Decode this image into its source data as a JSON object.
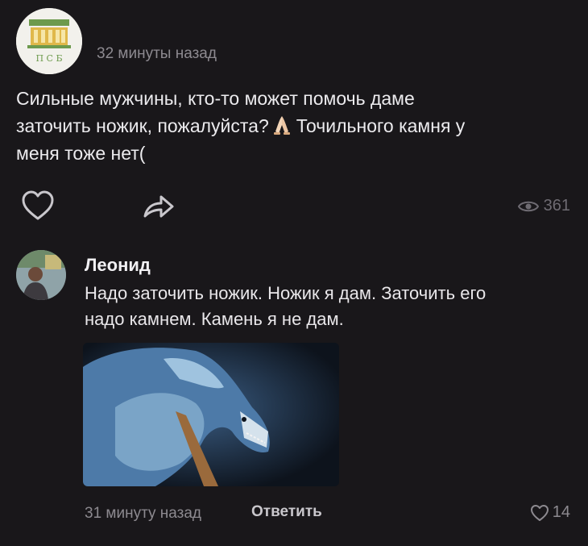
{
  "post": {
    "time": "32 минуты назад",
    "text_lines": [
      "Сильные мужчины, кто-то может помочь даме",
      "заточить ножик, пожалуйста?",
      "Точильного камня у",
      "меня тоже нет("
    ],
    "emoji": "praying-hands",
    "views": "361",
    "avatar_caption": "П С Б"
  },
  "comment": {
    "author": "Леонид",
    "text_lines": [
      "Надо заточить ножик. Ножик я дам. Заточить его",
      "надо камнем. Камень я не дам."
    ],
    "time": "31 минуту назад",
    "reply_label": "Ответить",
    "likes": "14"
  },
  "icons": {
    "like": "heart-outline-icon",
    "share": "share-arrow-icon",
    "views": "eye-icon",
    "comment_like": "heart-outline-icon"
  },
  "colors": {
    "background": "#19171a",
    "text": "#ecebee",
    "muted": "#8d8a90",
    "icon": "#c9c7cc"
  }
}
